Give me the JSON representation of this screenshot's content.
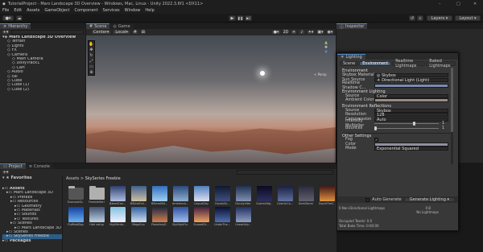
{
  "window_title": "TutorialProject - Mars Landscape 3D Overview - Windows, Mac, Linux - Unity 2022.3.6f1 <DX11>",
  "menu": [
    "File",
    "Edit",
    "Assets",
    "GameObject",
    "Component",
    "Services",
    "Window",
    "Help"
  ],
  "toolbar": {
    "layers": "Layers",
    "layout": "Layout"
  },
  "hierarchy": {
    "tab": "Hierarchy",
    "items": [
      {
        "label": "Mars Landscape 3D Overview",
        "indent": 0,
        "bold": true
      },
      {
        "label": "Terrain",
        "indent": 1
      },
      {
        "label": "Lights",
        "indent": 1
      },
      {
        "label": "FX",
        "indent": 1
      },
      {
        "label": "Camera",
        "indent": 1
      },
      {
        "label": "Main Camera",
        "indent": 2
      },
      {
        "label": "DollyTrack1",
        "indent": 2
      },
      {
        "label": "Cart",
        "indent": 2
      },
      {
        "label": "Audio",
        "indent": 1
      },
      {
        "label": "cal",
        "indent": 0
      },
      {
        "label": "Cube",
        "indent": 0
      },
      {
        "label": "Cube (1)",
        "indent": 0
      },
      {
        "label": "Cube (2)",
        "indent": 0
      }
    ]
  },
  "scene": {
    "tabs": [
      "Scene",
      "Game"
    ],
    "center": "Center",
    "local": "Local",
    "persp": "< Persp"
  },
  "inspector": {
    "tab": "Inspector"
  },
  "lighting": {
    "title": "Lighting",
    "tabs": [
      "Scene",
      "Environment",
      "Realtime Lightmaps",
      "Baked Lightmaps"
    ],
    "sections": {
      "environment": "Environment",
      "env_lighting": "Environment Lighting",
      "env_reflections": "Environment Reflections",
      "other": "Other Settings"
    },
    "rows": {
      "skybox_label": "Skybox Material",
      "skybox_value": "Skybox",
      "sun_label": "Sun Source",
      "sun_value": "Directional Light (Light)",
      "shadow_label": "Realtime Shadow C...",
      "source_label": "Source",
      "source_value": "Color",
      "ambient_label": "Ambient Color",
      "rsource_label": "Source",
      "rsource_value": "Skybox",
      "res_label": "Resolution",
      "res_value": "128",
      "comp_label": "Compression",
      "comp_value": "Auto",
      "intensity_label": "Intensity Multiplier",
      "intensity_value": "1",
      "bounces_label": "Bounces",
      "bounces_value": "1",
      "fog_label": "Fog",
      "color_label": "Color",
      "mode_label": "Mode",
      "mode_value": "Exponential Squared"
    },
    "auto_generate": "Auto Generate",
    "generate_button": "Generate Lighting",
    "stats": {
      "nondir": "0 Non-Directional Lightmaps",
      "nondir_size": "0 B",
      "no_lightmaps": "No Lightmaps",
      "occupied": "Occupied Texels: 0.0",
      "bake_time": "Total Bake Time: 0:00:00"
    }
  },
  "project": {
    "tabs": [
      "Project",
      "Console"
    ],
    "favorites": "Favorites",
    "tree": [
      {
        "label": "Assets",
        "indent": 0
      },
      {
        "label": "Mars Landscape 3D",
        "indent": 1
      },
      {
        "label": "Prefabs",
        "indent": 2
      },
      {
        "label": "Resources",
        "indent": 2
      },
      {
        "label": "Geometry",
        "indent": 3
      },
      {
        "label": "Materials",
        "indent": 3
      },
      {
        "label": "Sounds",
        "indent": 3
      },
      {
        "label": "Textures",
        "indent": 3
      },
      {
        "label": "Scenes",
        "indent": 2
      },
      {
        "label": "Mars Landscape 3D",
        "indent": 3
      },
      {
        "label": "Scenes",
        "indent": 1
      },
      {
        "label": "SkySeries Freebie",
        "indent": 1,
        "selected": true
      },
      {
        "label": "Packages",
        "indent": 0
      }
    ],
    "breadcrumb": [
      "Assets",
      "SkySeries Freebie"
    ],
    "row1": [
      "ExampleSc...",
      "FreebieHdri",
      "BakedCon...",
      "BSkiesFull...",
      "BSkiesMid...",
      "Ambience...",
      "CasualDay",
      "CloudsSk...",
      "CloudyInter...",
      "CosmicNig...",
      "CosmicCo..."
    ],
    "row2": [
      "DarkStorm",
      "DayInTheC...",
      "FluffballDay",
      "Hdri setup",
      "HighFanta...",
      "MegaSun",
      "PlanetaryE...",
      "SkyHighFlu...",
      "SunsetClr...",
      "UnderThe...",
      "UnearthIy..."
    ]
  },
  "colors": {
    "accent": "#4a8bd4",
    "panel": "#282828",
    "sky_top": "#4a5058",
    "ground": "#8a4a35"
  }
}
